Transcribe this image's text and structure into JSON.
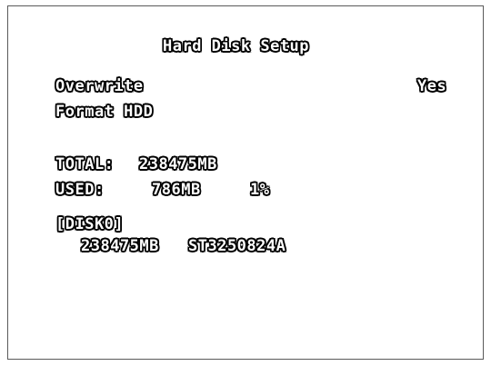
{
  "title": "Hard Disk Setup",
  "menu": {
    "overwrite": {
      "label": "Overwrite",
      "value": "Yes"
    },
    "format_hdd": {
      "label": "Format HDD"
    }
  },
  "storage": {
    "total_label": "TOTAL:",
    "total_value": "238475MB",
    "used_label": "USED:",
    "used_value": "786MB",
    "used_percent": "1%"
  },
  "disk": {
    "id": "[DISK0]",
    "size": "238475MB",
    "model": "ST3250824A"
  }
}
